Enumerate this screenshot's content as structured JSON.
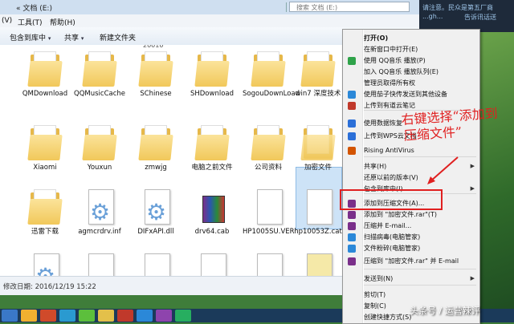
{
  "window": {
    "path": "« 文档 (E:)",
    "search_placeholder": "搜索 文档 (E:)"
  },
  "background_texts": [
    "请注意。民众是第五厂商",
    "...gh...",
    "告诉讯话送"
  ],
  "menubar": [
    "(V)",
    "工具(T)",
    "帮助(H)"
  ],
  "toolbar": {
    "include_label": "包含到库中",
    "share_label": "共享",
    "new_folder_label": "新建文件夹"
  },
  "files": {
    "row1": [
      "QMDownload",
      "QQMusicCache",
      "SChinese",
      "SHDownload",
      "SogouDownLoad",
      "win7 深度技术"
    ],
    "row2": [
      "Xiaomi",
      "Youxun",
      "zmwjg",
      "电脑之前文件",
      "公司资料",
      "加密文件"
    ],
    "row3": [
      "迅雷下载",
      "agmcrdrv.inf",
      "DIFxAPI.dll",
      "drv64.cab",
      "HP1005SU.VER",
      "hp10053Z.cat"
    ],
    "partial_top_label": "20010"
  },
  "status": {
    "modified": "修改日期: 2016/12/19 15:22"
  },
  "context_menu": {
    "items": [
      {
        "label": "打开(O)",
        "bold": true
      },
      {
        "label": "在新窗口中打开(E)"
      },
      {
        "label": "使用 QQ音乐 播放(P)",
        "icon": "qq-music-icon",
        "color": "#2fa34a"
      },
      {
        "label": "加入 QQ音乐 播放队列(E)"
      },
      {
        "label": "管理员取得所有权"
      },
      {
        "label": "使用茄子快传发送到其他设备",
        "icon": "share-icon",
        "color": "#2b88d8"
      },
      {
        "label": "上传到有道云笔记",
        "icon": "note-icon",
        "color": "#c0392b"
      },
      {
        "label": "使用数据恢复",
        "icon": "restore-icon",
        "color": "#2b6fd8"
      },
      {
        "label": "上传到WPS云文档",
        "icon": "cloud-icon",
        "color": "#2b6fd8"
      },
      {
        "label": "Rising AntiVirus",
        "icon": "shield-icon",
        "color": "#d35400"
      },
      {
        "label": "共享(H)",
        "submenu": true
      },
      {
        "label": "还原以前的版本(V)"
      },
      {
        "label": "包含到库中(I)",
        "submenu": true
      },
      {
        "label": "添加到压缩文件(A)...",
        "icon": "winrar-icon",
        "color": "#7a2f8a"
      },
      {
        "label": "添加到 \"加密文件.rar\"(T)",
        "icon": "winrar-icon",
        "color": "#7a2f8a"
      },
      {
        "label": "压缩并 E-mail...",
        "icon": "winrar-icon",
        "color": "#7a2f8a"
      },
      {
        "label": "扫描病毒(电脑管家)",
        "icon": "scan-icon",
        "color": "#2b88d8"
      },
      {
        "label": "文件粉碎(电脑管家)",
        "icon": "shred-icon",
        "color": "#2b88d8"
      },
      {
        "label": "压缩到 \"加密文件.rar\" 并 E-mail",
        "icon": "winrar-icon",
        "color": "#7a2f8a"
      },
      {
        "label": "发送到(N)",
        "submenu": true
      },
      {
        "label": "剪切(T)"
      },
      {
        "label": "复制(C)"
      },
      {
        "label": "创建快捷方式(S)"
      }
    ]
  },
  "annotation": {
    "text_line1": "右键选择“添加到",
    "text_line2": "压缩文件”",
    "color": "#e02020"
  },
  "watermark": "头条号 / 运营辣评"
}
